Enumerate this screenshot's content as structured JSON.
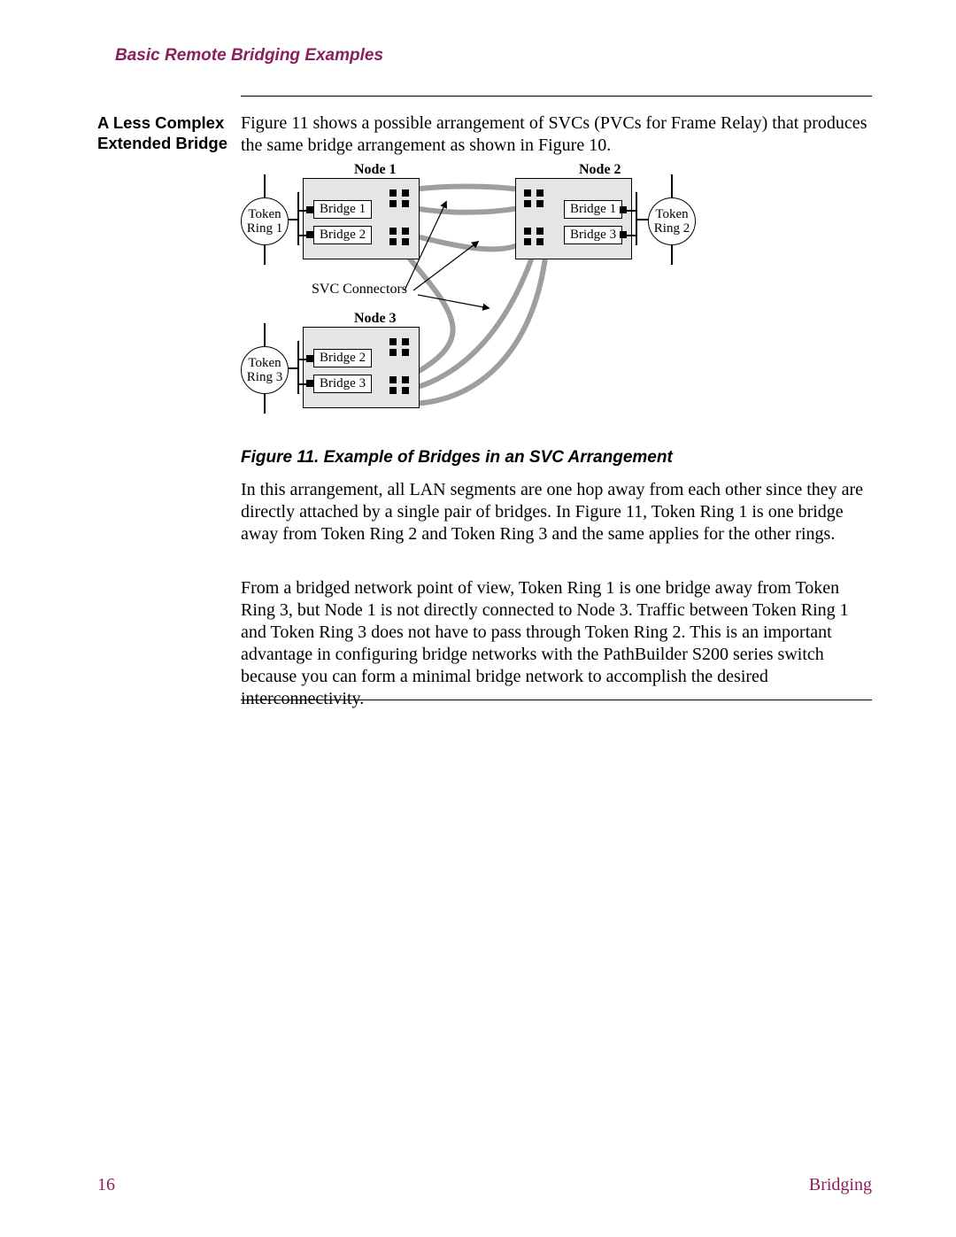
{
  "header": {
    "running_head": "Basic Remote Bridging Examples"
  },
  "section": {
    "side_heading": "A Less Complex Extended Bridge",
    "intro": "Figure 11 shows a possible arrangement of SVCs (PVCs for Frame Relay) that produces the same bridge arrangement as shown in Figure 10.",
    "caption": "Figure 11.  Example of Bridges in an SVC Arrangement",
    "para1": "In this arrangement, all LAN segments are one hop away from each other since they are directly attached by a single pair of bridges. In Figure 11, Token Ring 1 is one bridge away from Token Ring 2 and Token Ring 3 and the same applies for the other rings.",
    "para2": "From a bridged network point of view, Token Ring 1 is one bridge away from Token Ring 3, but Node 1 is not directly connected to Node 3. Traffic between Token Ring 1 and Token Ring 3 does not have to pass through Token Ring 2. This is an important advantage in configuring bridge networks with the PathBuilder S200 series switch because you can form a minimal bridge network to accomplish the desired interconnectivity."
  },
  "diagram": {
    "nodes": {
      "n1": "Node 1",
      "n2": "Node 2",
      "n3": "Node 3"
    },
    "rings": {
      "r1a": "Token",
      "r1b": "Ring 1",
      "r2a": "Token",
      "r2b": "Ring 2",
      "r3a": "Token",
      "r3b": "Ring 3"
    },
    "bridges": {
      "n1b1": "Bridge 1",
      "n1b2": "Bridge 2",
      "n2b1": "Bridge 1",
      "n2b3": "Bridge 3",
      "n3b2": "Bridge 2",
      "n3b3": "Bridge 3"
    },
    "svc_label": "SVC Connectors"
  },
  "footer": {
    "page_number": "16",
    "doc_name": "Bridging"
  }
}
